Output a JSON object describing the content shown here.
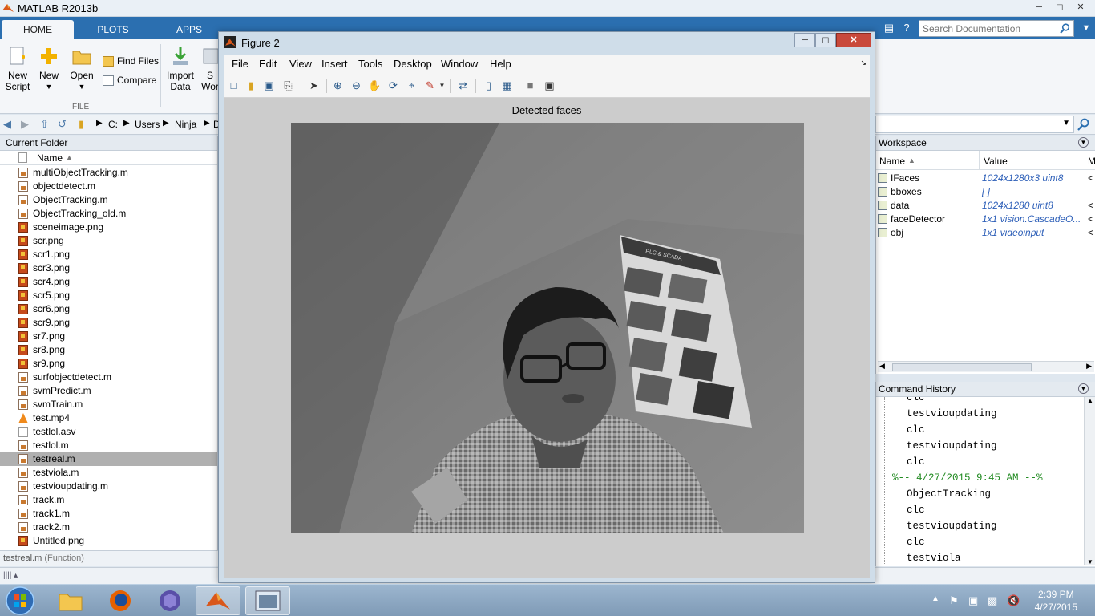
{
  "window": {
    "title": "MATLAB R2013b"
  },
  "ribbon": {
    "tabs": [
      "HOME",
      "PLOTS",
      "APPS"
    ],
    "search_placeholder": "Search Documentation",
    "buttons": {
      "new_script": "New\nScript",
      "new": "New",
      "open": "Open",
      "find_files": "Find Files",
      "compare": "Compare",
      "import_data": "Import\nData",
      "save_workspace_partial": "S\nWor"
    },
    "group_file": "FILE"
  },
  "address": {
    "crumbs": [
      "C:",
      "Users",
      "Ninja",
      "D"
    ]
  },
  "current_folder": {
    "title": "Current Folder",
    "column_name": "Name",
    "files": [
      {
        "name": "multiObjectTracking.m",
        "type": "m"
      },
      {
        "name": "objectdetect.m",
        "type": "m"
      },
      {
        "name": "ObjectTracking.m",
        "type": "m"
      },
      {
        "name": "ObjectTracking_old.m",
        "type": "m"
      },
      {
        "name": "sceneimage.png",
        "type": "png"
      },
      {
        "name": "scr.png",
        "type": "png"
      },
      {
        "name": "scr1.png",
        "type": "png"
      },
      {
        "name": "scr3.png",
        "type": "png"
      },
      {
        "name": "scr4.png",
        "type": "png"
      },
      {
        "name": "scr5.png",
        "type": "png"
      },
      {
        "name": "scr6.png",
        "type": "png"
      },
      {
        "name": "scr9.png",
        "type": "png"
      },
      {
        "name": "sr7.png",
        "type": "png"
      },
      {
        "name": "sr8.png",
        "type": "png"
      },
      {
        "name": "sr9.png",
        "type": "png"
      },
      {
        "name": "surfobjectdetect.m",
        "type": "m"
      },
      {
        "name": "svmPredict.m",
        "type": "m"
      },
      {
        "name": "svmTrain.m",
        "type": "m"
      },
      {
        "name": "test.mp4",
        "type": "vlc"
      },
      {
        "name": "testlol.asv",
        "type": "doc"
      },
      {
        "name": "testlol.m",
        "type": "m"
      },
      {
        "name": "testreal.m",
        "type": "m",
        "selected": true
      },
      {
        "name": "testviola.m",
        "type": "m"
      },
      {
        "name": "testvioupdating.m",
        "type": "m"
      },
      {
        "name": "track.m",
        "type": "m"
      },
      {
        "name": "track1.m",
        "type": "m"
      },
      {
        "name": "track2.m",
        "type": "m"
      },
      {
        "name": "Untitled.png",
        "type": "png"
      }
    ],
    "status_file": "testreal.m",
    "status_kind": "(Function)"
  },
  "workspace": {
    "title": "Workspace",
    "col_name": "Name",
    "col_value": "Value",
    "col_min": "M",
    "vars": [
      {
        "name": "IFaces",
        "value": "1024x1280x3 uint8",
        "extra": "<"
      },
      {
        "name": "bboxes",
        "value": "[ ]",
        "extra": ""
      },
      {
        "name": "data",
        "value": "1024x1280 uint8",
        "extra": "<"
      },
      {
        "name": "faceDetector",
        "value": "1x1 vision.CascadeO...",
        "extra": "<"
      },
      {
        "name": "obj",
        "value": "1x1 videoinput",
        "extra": "<"
      }
    ]
  },
  "command_history": {
    "title": "Command History",
    "lines": [
      {
        "text": "clc",
        "kind": "cmd"
      },
      {
        "text": "testvioupdating",
        "kind": "cmd"
      },
      {
        "text": "clc",
        "kind": "cmd"
      },
      {
        "text": "testvioupdating",
        "kind": "cmd"
      },
      {
        "text": "clc",
        "kind": "cmd"
      },
      {
        "text": "%-- 4/27/2015 9:45 AM --%",
        "kind": "sep"
      },
      {
        "text": "ObjectTracking",
        "kind": "cmd"
      },
      {
        "text": "clc",
        "kind": "cmd"
      },
      {
        "text": "testvioupdating",
        "kind": "cmd"
      },
      {
        "text": "clc",
        "kind": "cmd"
      },
      {
        "text": "testviola",
        "kind": "cmd"
      }
    ]
  },
  "figure": {
    "title": "Figure 2",
    "menu": [
      "File",
      "Edit",
      "View",
      "Insert",
      "Tools",
      "Desktop",
      "Window",
      "Help"
    ],
    "axes_title": "Detected faces",
    "poster_caption": "PLC & SCADA"
  },
  "taskbar": {
    "time": "2:39 PM",
    "date": "4/27/2015"
  },
  "colors": {
    "ribbon_blue": "#2b6fb0",
    "workspace_value": "#2d5fb8",
    "history_separator": "#228b22",
    "close_red": "#c9493b"
  }
}
